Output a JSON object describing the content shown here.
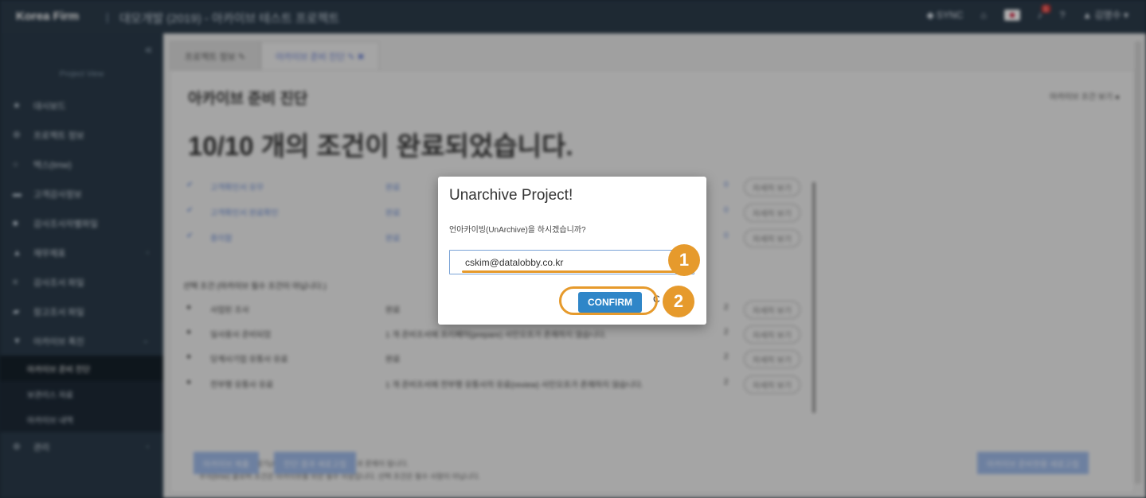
{
  "topbar": {
    "brand": "Korea Firm",
    "project": "대모개발 (2019) - 아카이브 테스트 프로젝트",
    "sync": "SYNC",
    "user": "김명수",
    "notification_count": "1"
  },
  "sidebar": {
    "caption": "Project View",
    "items": [
      {
        "label": "대시보드"
      },
      {
        "label": "프로젝트 정보"
      },
      {
        "label": "택스(tmw)"
      },
      {
        "label": "고객감사정보"
      },
      {
        "label": "감사조사자별파일"
      },
      {
        "label": "재무제표"
      },
      {
        "label": "감사조서 파일"
      },
      {
        "label": "참고조서 파일"
      },
      {
        "label": "아카이브 폭진"
      },
      {
        "label": "아카이브 준비 진단"
      },
      {
        "label": "보관리스 자료"
      },
      {
        "label": "아카이브 내역"
      },
      {
        "label": "관리"
      }
    ]
  },
  "tabs": [
    {
      "label": "프로젝트 정보"
    },
    {
      "label": "아카이브 준비 진단"
    }
  ],
  "panel": {
    "heading": "아카이브 준비 진단",
    "right_link": "아카이브 조건 보기",
    "big_text": "10/10 개의 조건이 완료되었습니다.",
    "section_title": "선택 조건 (아카이브 필수 조건이 아닙니다.)",
    "status_btn": "자세히 보기",
    "notes": [
      "클로버 시사요프가 알기(ApI)으시 있는 할지되시 발편과 문제이 됩니다.",
      "주의(tmw) 클로버 조건은 아카이브를 위한 필수 사항입니다. 선택 조건은 필수 사항이 아닙니다."
    ],
    "buttons": [
      "아카이브 제출",
      "진단 결과 새로고침"
    ],
    "right_button": "아카이브 준비현황 새로고침",
    "rows": [
      {
        "mark": "✔",
        "name": "고객확인서 유무",
        "status": "완료",
        "count": "0"
      },
      {
        "mark": "✔",
        "name": "고객확인서 완료확인",
        "status": "완료",
        "count": "0"
      },
      {
        "mark": "✔",
        "name": "종이함",
        "status": "완료",
        "count": "0"
      },
      {
        "mark": "●",
        "name": "사업된 조사",
        "status": "완료",
        "count": "2"
      },
      {
        "mark": "●",
        "name": "일사용사 준비되었",
        "status": "1 개 준비조서에 프리페어(prepare) 사인오프가 존재하지 않습니다.",
        "count": "2"
      },
      {
        "mark": "●",
        "name": "당계사기업 유통사 유료",
        "status": "완료",
        "count": "2"
      },
      {
        "mark": "●",
        "name": "전부행 유통사 유료",
        "status": "1 개 준비조서에 전부행 유통사의 유료(review) 사인오프가 존재하지 않습니다.",
        "count": "2"
      }
    ]
  },
  "modal": {
    "title": "Unarchive Project!",
    "message": "언아카이빙(UnArchive)을 하시겠습니까?",
    "input_value": "cskim@datalobby.co.kr",
    "confirm_label": "CONFIRM",
    "cancel_peek": "C",
    "step1": "1",
    "step2": "2",
    "accent_color": "#e69a2c",
    "button_color": "#2f86c8"
  }
}
